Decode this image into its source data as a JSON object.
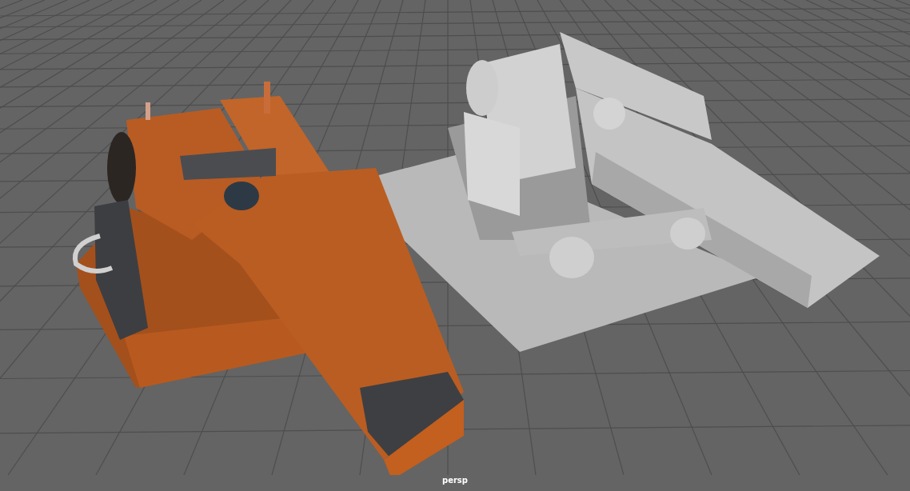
{
  "viewport": {
    "camera_label": "persp"
  }
}
